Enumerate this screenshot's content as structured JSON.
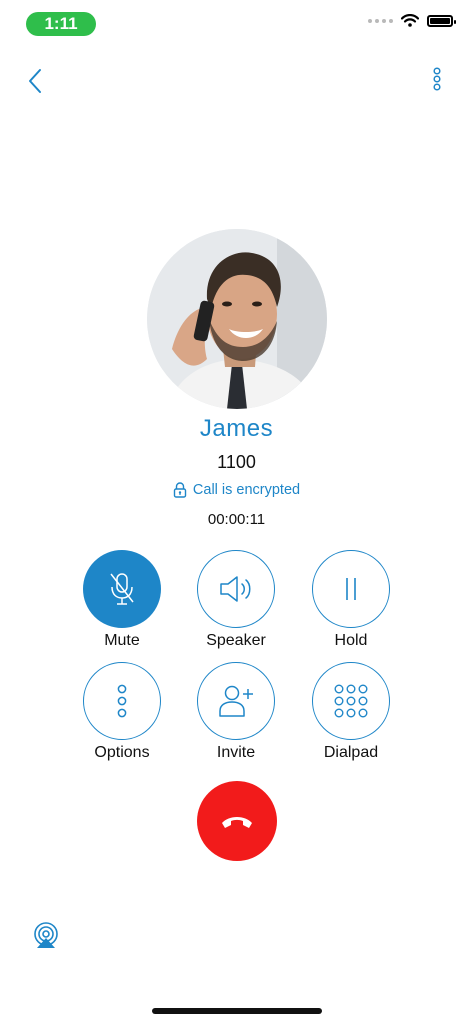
{
  "status_bar": {
    "time": "1:11"
  },
  "caller": {
    "name": "James",
    "number": "1100",
    "encryption_text": "Call is encrypted",
    "duration": "00:00:11"
  },
  "actions": [
    {
      "label": "Mute",
      "icon": "mic-off-icon",
      "active": true
    },
    {
      "label": "Speaker",
      "icon": "speaker-icon",
      "active": false
    },
    {
      "label": "Hold",
      "icon": "pause-icon",
      "active": false
    },
    {
      "label": "Options",
      "icon": "vertical-dots-icon",
      "active": false
    },
    {
      "label": "Invite",
      "icon": "add-user-icon",
      "active": false
    },
    {
      "label": "Dialpad",
      "icon": "dialpad-icon",
      "active": false
    }
  ],
  "colors": {
    "accent": "#1e86c8",
    "end_call": "#f21b1b",
    "status_pill": "#2fbe4b"
  }
}
